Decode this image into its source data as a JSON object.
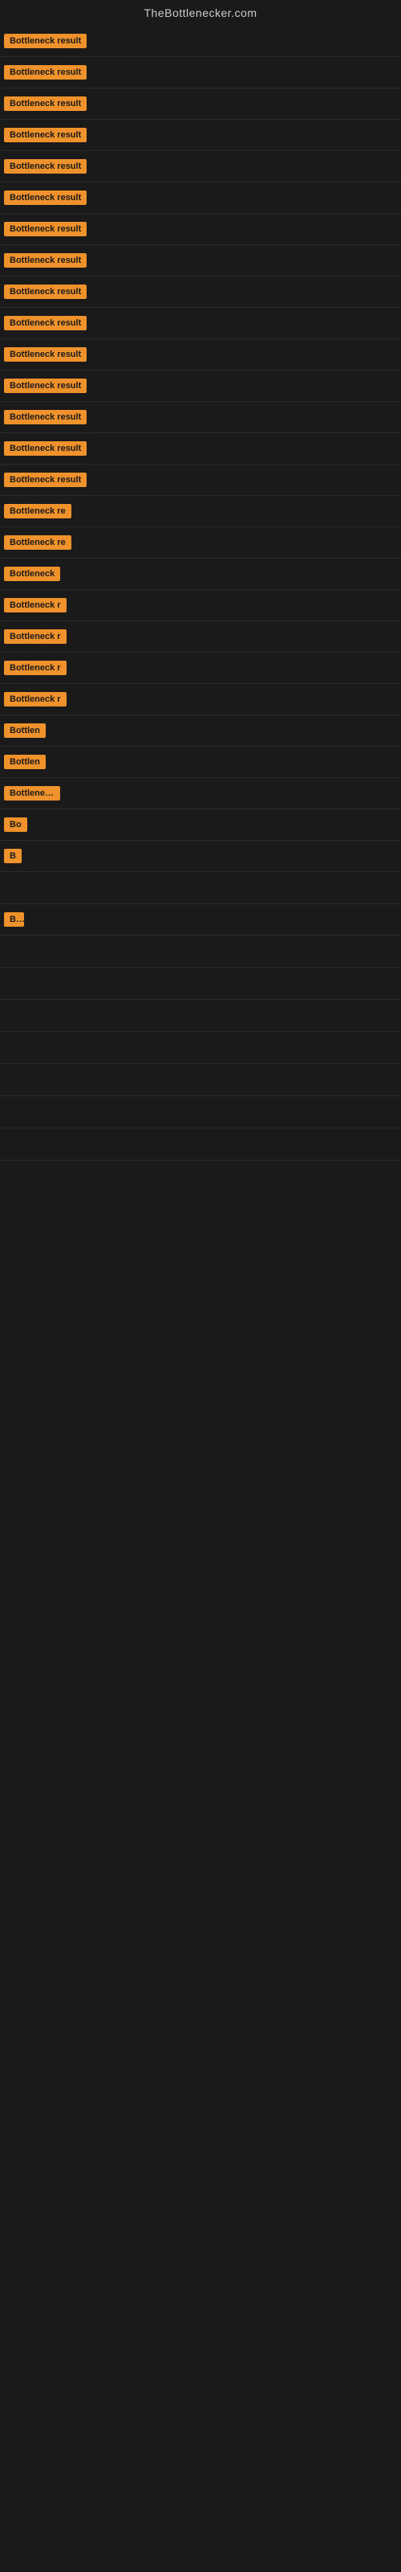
{
  "site": {
    "title": "TheBottlenecker.com"
  },
  "badge_label": "Bottleneck result",
  "rows": [
    {
      "id": 1,
      "shrink": 0,
      "visible": true
    },
    {
      "id": 2,
      "shrink": 0,
      "visible": true
    },
    {
      "id": 3,
      "shrink": 0,
      "visible": true
    },
    {
      "id": 4,
      "shrink": 0,
      "visible": true
    },
    {
      "id": 5,
      "shrink": 0,
      "visible": true
    },
    {
      "id": 6,
      "shrink": 0,
      "visible": true
    },
    {
      "id": 7,
      "shrink": 0,
      "visible": true
    },
    {
      "id": 8,
      "shrink": 0,
      "visible": true
    },
    {
      "id": 9,
      "shrink": 0,
      "visible": true
    },
    {
      "id": 10,
      "shrink": 0,
      "visible": true
    },
    {
      "id": 11,
      "shrink": 0,
      "visible": true
    },
    {
      "id": 12,
      "shrink": 0,
      "visible": true
    },
    {
      "id": 13,
      "shrink": 0,
      "visible": true
    },
    {
      "id": 14,
      "shrink": 0,
      "visible": true
    },
    {
      "id": 15,
      "shrink": 0,
      "visible": true
    },
    {
      "id": 16,
      "shrink": 1,
      "visible": true
    },
    {
      "id": 17,
      "shrink": 1,
      "visible": true
    },
    {
      "id": 18,
      "shrink": 2,
      "visible": true
    },
    {
      "id": 19,
      "shrink": 3,
      "visible": true
    },
    {
      "id": 20,
      "shrink": 3,
      "visible": true
    },
    {
      "id": 21,
      "shrink": 3,
      "visible": true
    },
    {
      "id": 22,
      "shrink": 3,
      "visible": true
    },
    {
      "id": 23,
      "shrink": 4,
      "visible": true
    },
    {
      "id": 24,
      "shrink": 4,
      "visible": true
    },
    {
      "id": 25,
      "shrink": 5,
      "visible": true
    },
    {
      "id": 26,
      "shrink": 6,
      "visible": true
    },
    {
      "id": 27,
      "shrink": 7,
      "visible": true
    },
    {
      "id": 28,
      "shrink": 0,
      "visible": false
    },
    {
      "id": 29,
      "shrink": 8,
      "visible": true
    },
    {
      "id": 30,
      "shrink": 0,
      "visible": false
    },
    {
      "id": 31,
      "shrink": 0,
      "visible": false
    },
    {
      "id": 32,
      "shrink": 0,
      "visible": false
    },
    {
      "id": 33,
      "shrink": 0,
      "visible": false
    },
    {
      "id": 34,
      "shrink": 0,
      "visible": false
    },
    {
      "id": 35,
      "shrink": 0,
      "visible": false
    },
    {
      "id": 36,
      "shrink": 0,
      "visible": false
    }
  ]
}
